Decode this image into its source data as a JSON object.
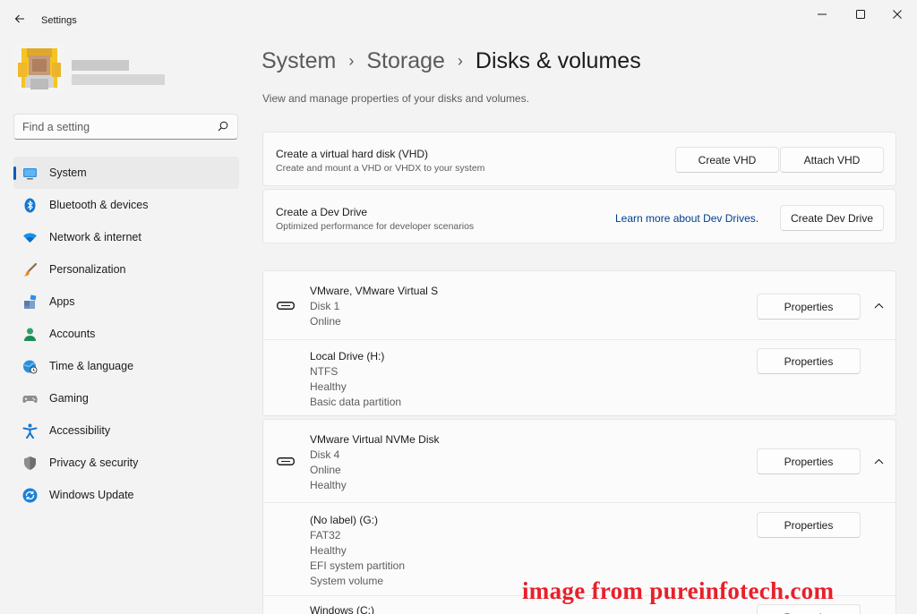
{
  "window": {
    "app_title": "Settings"
  },
  "search": {
    "placeholder": "Find a setting"
  },
  "sidebar": {
    "items": [
      {
        "label": "System",
        "icon": "monitor-icon",
        "active": true
      },
      {
        "label": "Bluetooth & devices",
        "icon": "bluetooth-icon"
      },
      {
        "label": "Network & internet",
        "icon": "wifi-icon"
      },
      {
        "label": "Personalization",
        "icon": "brush-icon"
      },
      {
        "label": "Apps",
        "icon": "apps-icon"
      },
      {
        "label": "Accounts",
        "icon": "person-icon"
      },
      {
        "label": "Time & language",
        "icon": "globe-clock-icon"
      },
      {
        "label": "Gaming",
        "icon": "gamepad-icon"
      },
      {
        "label": "Accessibility",
        "icon": "accessibility-icon"
      },
      {
        "label": "Privacy & security",
        "icon": "shield-icon"
      },
      {
        "label": "Windows Update",
        "icon": "update-icon"
      }
    ]
  },
  "breadcrumb": {
    "items": [
      "System",
      "Storage"
    ],
    "current": "Disks & volumes"
  },
  "page": {
    "description": "View and manage properties of your disks and volumes."
  },
  "vhd_card": {
    "title": "Create a virtual hard disk (VHD)",
    "subtitle": "Create and mount a VHD or VHDX to your system",
    "create_button": "Create VHD",
    "attach_button": "Attach VHD"
  },
  "devdrive_card": {
    "title": "Create a Dev Drive",
    "subtitle": "Optimized performance for developer scenarios",
    "link": "Learn more about Dev Drives.",
    "create_button": "Create Dev Drive"
  },
  "disks": [
    {
      "name": "VMware, VMware Virtual S",
      "disk": "Disk 1",
      "status": "Online",
      "properties_button": "Properties",
      "volumes": [
        {
          "name": "Local Drive (H:)",
          "fs": "NTFS",
          "health": "Healthy",
          "type": "Basic data partition",
          "properties_button": "Properties"
        }
      ]
    },
    {
      "name": "VMware Virtual NVMe Disk",
      "disk": "Disk 4",
      "status": "Online",
      "health": "Healthy",
      "properties_button": "Properties",
      "volumes": [
        {
          "name": "(No label) (G:)",
          "fs": "FAT32",
          "health": "Healthy",
          "type": "EFI system partition",
          "extra": "System volume",
          "properties_button": "Properties"
        },
        {
          "name": "Windows (C:)",
          "properties_button": "Properties"
        }
      ]
    }
  ],
  "watermark": "image from pureinfotech.com",
  "colors": {
    "accent": "#005fb8",
    "watermark": "#e8202a"
  }
}
